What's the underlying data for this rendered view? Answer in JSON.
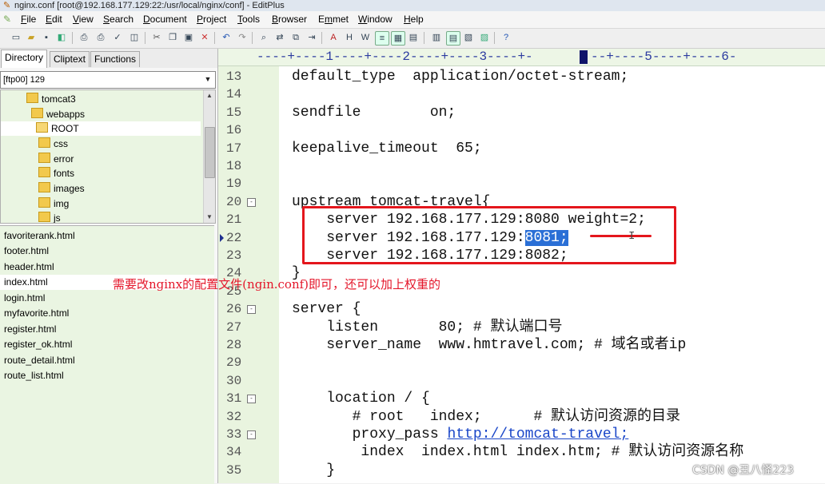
{
  "window": {
    "title": "nginx.conf [root@192.168.177.129:22:/usr/local/nginx/conf] - EditPlus"
  },
  "menu": [
    {
      "pre": "",
      "ul": "F",
      "post": "ile"
    },
    {
      "pre": "",
      "ul": "E",
      "post": "dit"
    },
    {
      "pre": "",
      "ul": "V",
      "post": "iew"
    },
    {
      "pre": "",
      "ul": "S",
      "post": "earch"
    },
    {
      "pre": "",
      "ul": "D",
      "post": "ocument"
    },
    {
      "pre": "",
      "ul": "P",
      "post": "roject"
    },
    {
      "pre": "",
      "ul": "T",
      "post": "ools"
    },
    {
      "pre": "",
      "ul": "B",
      "post": "rowser"
    },
    {
      "pre": "E",
      "ul": "m",
      "post": "met"
    },
    {
      "pre": "",
      "ul": "W",
      "post": "indow"
    },
    {
      "pre": "",
      "ul": "H",
      "post": "elp"
    }
  ],
  "sidebar": {
    "tabs": [
      "Directory",
      "Cliptext",
      "Functions"
    ],
    "drive": "[ftp00] 129",
    "tree": [
      {
        "label": "tomcat3"
      },
      {
        "label": "webapps"
      },
      {
        "label": "ROOT"
      },
      {
        "label": "css"
      },
      {
        "label": "error"
      },
      {
        "label": "fonts"
      },
      {
        "label": "images"
      },
      {
        "label": "img"
      },
      {
        "label": "js"
      }
    ],
    "files": [
      "favoriterank.html",
      "footer.html",
      "header.html",
      "index.html",
      "login.html",
      "myfavorite.html",
      "register.html",
      "register_ok.html",
      "route_detail.html",
      "route_list.html"
    ]
  },
  "ruler": {
    "marks": "----+----1----+----2----+----3----+-",
    "marks_right": "--+----5----+----6-"
  },
  "editor": {
    "line_numbers": [
      "13",
      "14",
      "15",
      "16",
      "17",
      "18",
      "19",
      "20",
      "21",
      "22",
      "23",
      "24",
      "25",
      "26",
      "27",
      "28",
      "29",
      "30",
      "31",
      "32",
      "33",
      "34",
      "35"
    ],
    "lines": [
      "default_type  application/octet-stream;",
      "",
      "sendfile        on;",
      "",
      "keepalive_timeout  65;",
      "",
      "",
      "upstream tomcat-travel{",
      "    server 192.168.177.129:8080 weight=2;",
      "    server 192.168.177.129:",
      "    server 192.168.177.129:8082;",
      "}",
      "",
      "server {",
      "    listen       80; # 默认端口号",
      "    server_name  www.hmtravel.com; # 域名或者ip",
      "",
      "",
      "    location / {",
      "       # root   index;      # 默认访问资源的目录",
      "       proxy_pass ",
      "        index  index.html index.htm; # 默认访问资源名称",
      "    }"
    ],
    "selected_text": "8081;",
    "link_text": "http://tomcat-travel;"
  },
  "annotation_note": "需要改nginx的配置文件(ngin.conf)即可，还可以加上权重的",
  "watermark": "CSDN @丑八怪223"
}
